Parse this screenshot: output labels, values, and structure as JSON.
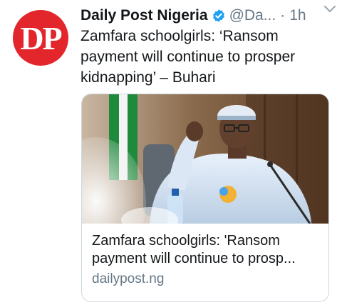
{
  "tweet": {
    "display_name": "Daily Post Nigeria",
    "handle": "@Da...",
    "separator": "·",
    "time": "1h",
    "avatar_text": "DP",
    "text": "Zamfara schoolgirls: ‘Ransom payment will continue to prosper kidnapping’ – Buhari"
  },
  "card": {
    "title": "Zamfara schoolgirls: 'Ransom payment will continue to prosp...",
    "domain": "dailypost.ng",
    "image_icon": "news-photo"
  },
  "icons": {
    "verified": "verified-badge-icon",
    "menu": "chevron-down-icon"
  },
  "colors": {
    "avatar_bg": "#e2262b",
    "verified": "#1da1f2",
    "secondary_text": "#657786",
    "card_border": "#ccd6dd"
  }
}
